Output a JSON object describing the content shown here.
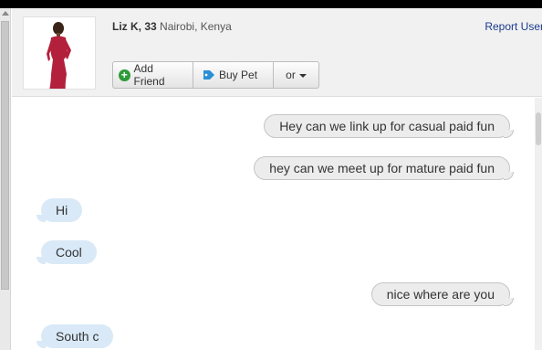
{
  "profile": {
    "name": "Liz K,",
    "age": "33",
    "location": "Nairobi, Kenya",
    "report_label": "Report User"
  },
  "actions": {
    "add_friend_label": "Add Friend",
    "buy_pet_label": "Buy Pet",
    "more_label": "or"
  },
  "messages": [
    {
      "direction": "outgoing",
      "text": "Hey can we link up for casual paid fun"
    },
    {
      "direction": "outgoing",
      "text": "hey can we meet up for mature paid fun"
    },
    {
      "direction": "incoming",
      "text": "Hi"
    },
    {
      "direction": "incoming",
      "text": "Cool"
    },
    {
      "direction": "outgoing",
      "text": "nice where are you"
    },
    {
      "direction": "incoming",
      "text": "South c"
    }
  ],
  "colors": {
    "outgoing_bubble": "#ececec",
    "incoming_bubble": "#d9e9f7",
    "link": "#1a3a8a",
    "add_icon": "#2e9b3a",
    "tag_icon": "#2b8fd6",
    "avatar_dress": "#b3203c"
  }
}
